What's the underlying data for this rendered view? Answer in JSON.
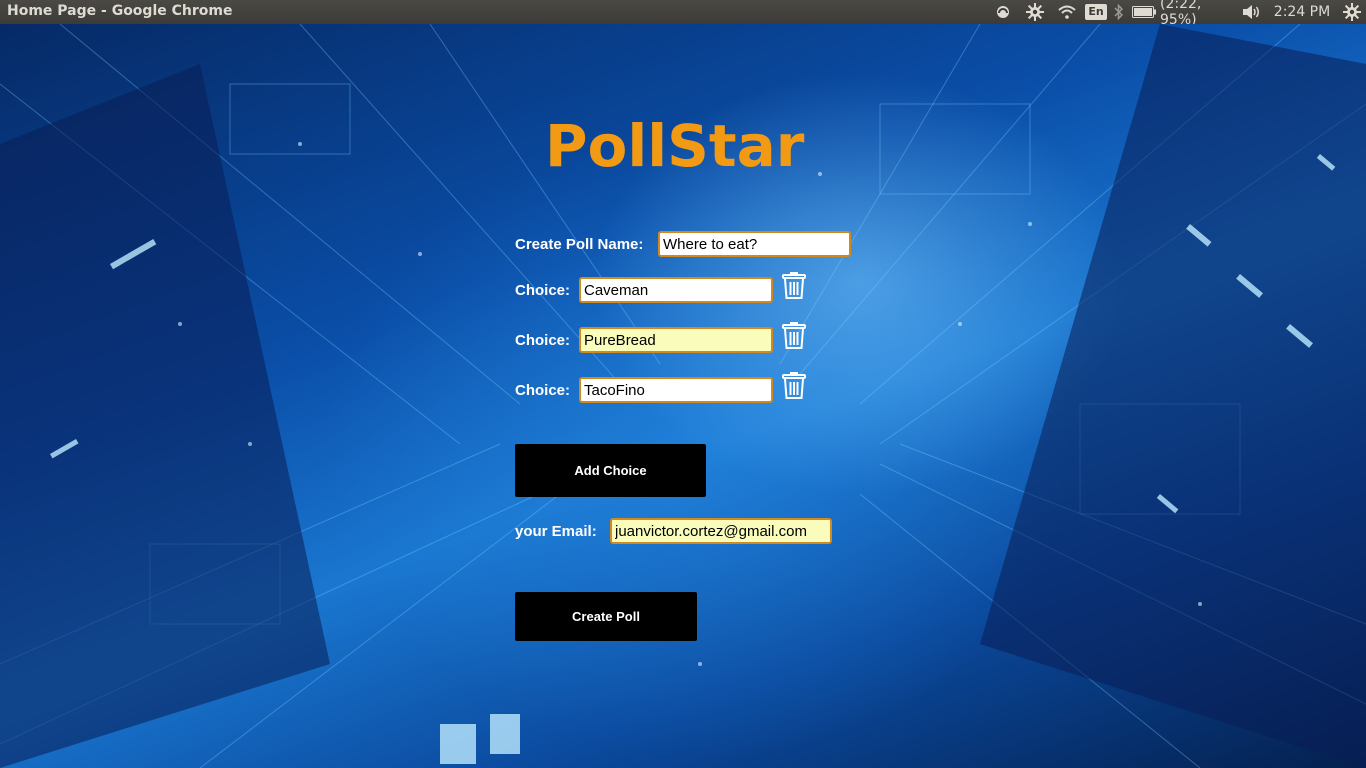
{
  "window": {
    "title": "Home Page - Google Chrome"
  },
  "tray": {
    "icons": [
      "sync-icon",
      "settings-icon",
      "wifi-icon",
      "bluetooth-icon",
      "battery-icon",
      "volume-icon",
      "power-icon"
    ],
    "language": "En",
    "battery_text": "(2:22, 95%)",
    "clock": "2:24 PM"
  },
  "app": {
    "logo_text": "PollStar",
    "logo_color": "#f29a13",
    "poll_name_label": "Create Poll Name:",
    "poll_name_value": "Where to eat?",
    "choice_label": "Choice:",
    "choices": [
      {
        "label": "Choice:",
        "value": "Caveman"
      },
      {
        "label": "Choice:",
        "value": "PureBread"
      },
      {
        "label": "Choice:",
        "value": "TacoFino"
      }
    ],
    "add_choice_label": "Add Choice",
    "email_label": "your Email:",
    "email_value": "juanvictor.cortez@gmail.com",
    "create_poll_label": "Create Poll"
  }
}
